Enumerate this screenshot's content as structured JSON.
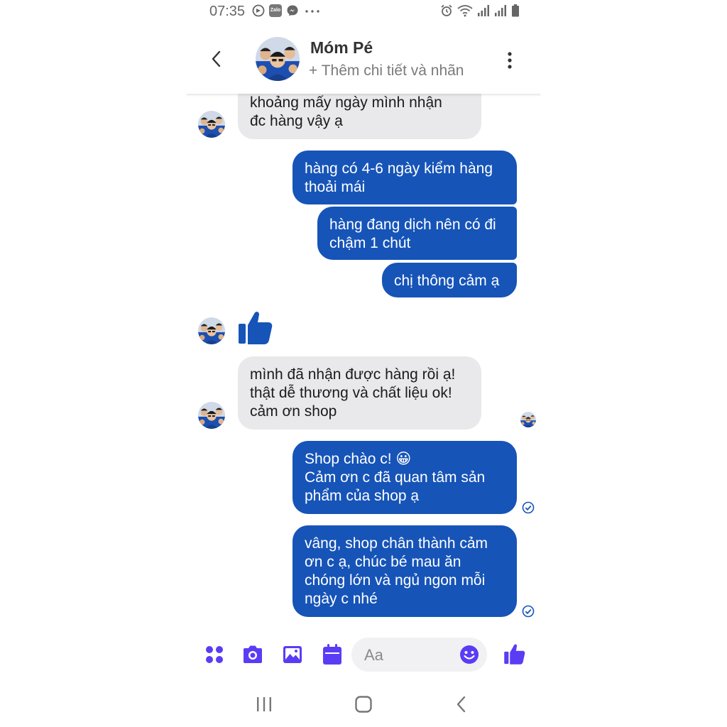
{
  "status_bar": {
    "time": "07:35",
    "zalo_label": "Zalo"
  },
  "header": {
    "contact_name": "Móm Pé",
    "subtitle": "+ Thêm chi tiết và nhãn"
  },
  "messages": [
    {
      "from": "contact",
      "text": "khoảng mấy ngày mình nhận\nđc hàng vậy ạ"
    },
    {
      "from": "me",
      "text": "hàng có 4-6 ngày kiểm hàng\nthoải mái"
    },
    {
      "from": "me",
      "text": "hàng đang dịch nên có đi\nchậm 1 chút"
    },
    {
      "from": "me",
      "text": "chị thông cảm ạ"
    },
    {
      "from": "contact",
      "type": "like"
    },
    {
      "from": "contact",
      "text": "mình đã nhận được hàng rồi ạ!\nthật dễ thương và chất liệu ok!\ncảm ơn shop"
    },
    {
      "from": "me",
      "text": "Shop chào c! 😀\nCảm ơn c đã quan tâm sản\nphẩm của shop ạ"
    },
    {
      "from": "me",
      "text": "vâng, shop chân thành cảm\nơn c ạ, chúc bé mau ăn\nchóng lớn và ngủ ngon mỗi\nngày c nhé"
    }
  ],
  "composer": {
    "placeholder": "Aa"
  },
  "colors": {
    "accent": "#1654b8",
    "composer_icons": "#5b3cf5",
    "incoming_bubble": "#e9e9eb"
  },
  "icons": {
    "composer": [
      "apps-icon",
      "camera-icon",
      "gallery-icon",
      "calendar-icon",
      "emoji-icon",
      "thumbs-up-icon"
    ],
    "nav": [
      "recent-apps-icon",
      "home-icon",
      "back-nav-icon"
    ]
  }
}
